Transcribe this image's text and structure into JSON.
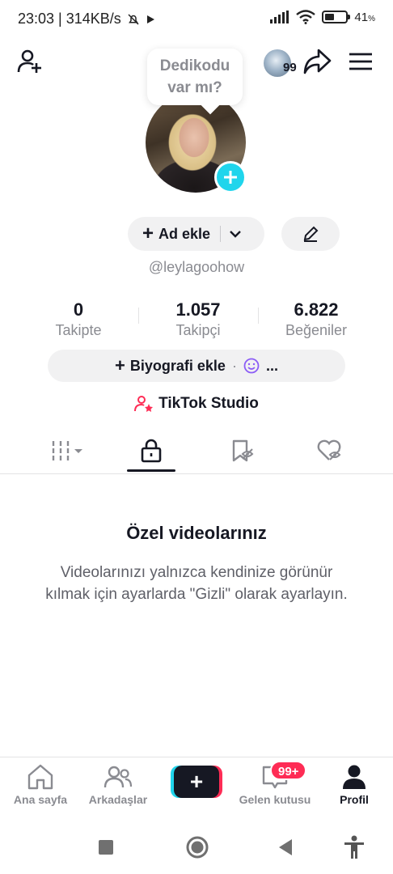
{
  "status_bar": {
    "time_speed": "23:03 | 314KB/s",
    "battery_pct": "41",
    "battery_unit": "%"
  },
  "profile": {
    "bubble_text_line1": "Dedikodu",
    "bubble_text_line2": "var mı?",
    "mini_avatar_badge": "99",
    "add_name_label": "Ad ekle",
    "username": "@leylagoohow"
  },
  "stats": [
    {
      "value": "0",
      "label": "Takipte"
    },
    {
      "value": "1.057",
      "label": "Takipçi"
    },
    {
      "value": "6.822",
      "label": "Beğeniler"
    }
  ],
  "bio": {
    "label": "Biyografi ekle",
    "dot": "·",
    "more": "..."
  },
  "studio": {
    "label": "TikTok Studio"
  },
  "empty_state": {
    "title": "Özel videolarınız",
    "description": "Videolarınızı yalnızca kendinize görünür kılmak için ayarlarda \"Gizli\" olarak ayarlayın."
  },
  "bottom_nav": {
    "home": "Ana sayfa",
    "friends": "Arkadaşlar",
    "inbox": "Gelen kutusu",
    "inbox_badge": "99+",
    "profile": "Profil"
  },
  "colors": {
    "accent_cyan": "#20d5ec",
    "accent_red": "#fe2c55",
    "text_primary": "#161823",
    "text_secondary": "#8a8b91"
  }
}
